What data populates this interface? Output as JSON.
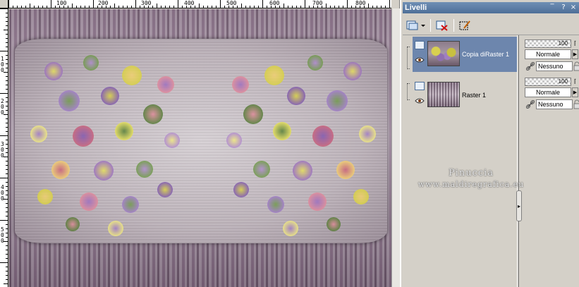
{
  "ruler": {
    "h_labels": [
      "100",
      "200",
      "300",
      "400",
      "500",
      "600",
      "700",
      "800"
    ],
    "v_labels": [
      "1\n0\n0",
      "2\n0\n0",
      "3\n0\n0",
      "4\n0\n0",
      "5\n0\n0"
    ]
  },
  "layers_panel": {
    "title": "Livelli",
    "title_buttons": [
      "pin-icon",
      "minimize-icon",
      "close-icon"
    ],
    "toolbar": [
      "new-layer-icon",
      "delete-layer-icon",
      "edit-selection-icon"
    ],
    "layers": [
      {
        "name": "Copia diRaster 1",
        "selected": true,
        "opacity": "100",
        "blend": "Normale",
        "link": "Nessuno"
      },
      {
        "name": "Raster 1",
        "selected": false,
        "opacity": "100",
        "blend": "Normale",
        "link": "Nessuno"
      }
    ]
  },
  "watermark": {
    "line1": "Pinuccia",
    "line2": "www.maldiregrafica.eu"
  },
  "colors": {
    "title_bar": "#4e6f98",
    "selected_layer": "#6d86ad",
    "panel_bg": "#d4d0c8"
  }
}
